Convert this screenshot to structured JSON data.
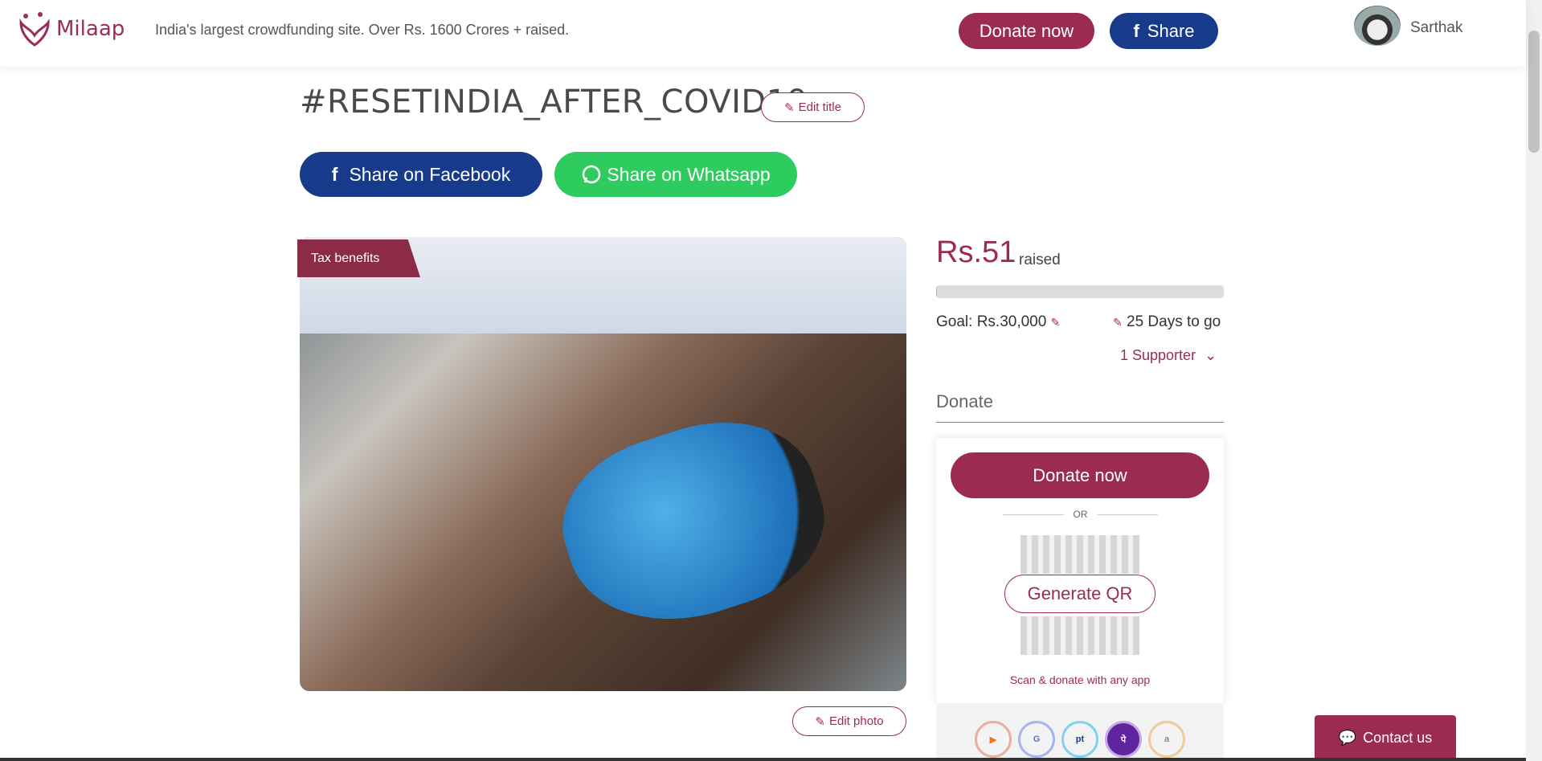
{
  "header": {
    "logo_text": "Milaap",
    "tagline": "India's largest crowdfunding site. Over Rs. 1600 Crores + raised.",
    "donate_label": "Donate now",
    "share_label": "Share",
    "username": "Sarthak"
  },
  "campaign": {
    "title": "#RESETINDIA_AFTER_COVID19",
    "edit_title_label": "Edit title",
    "share_facebook_label": "Share on Facebook",
    "share_whatsapp_label": "Share on Whatsapp",
    "tax_badge": "Tax benefits",
    "edit_photo_label": "Edit photo"
  },
  "funding": {
    "raised_amount": "Rs.51",
    "raised_label": "raised",
    "progress_fraction": 0.002,
    "goal_text": "Goal: Rs.30,000",
    "days_text": "25 Days to go",
    "supporters_text": "1 Supporter"
  },
  "donate_card": {
    "heading": "Donate",
    "donate_label": "Donate now",
    "or_label": "OR",
    "generate_qr_label": "Generate QR",
    "scan_text": "Scan & donate with any app",
    "apps": [
      "bhim-icon",
      "gpay-icon",
      "paytm-icon",
      "phonepe-icon",
      "amazonpay-icon"
    ]
  },
  "contact": {
    "label": "Contact us"
  },
  "colors": {
    "brand": "#9c2c4f",
    "facebook": "#173a8a",
    "whatsapp": "#2ecc5f"
  }
}
